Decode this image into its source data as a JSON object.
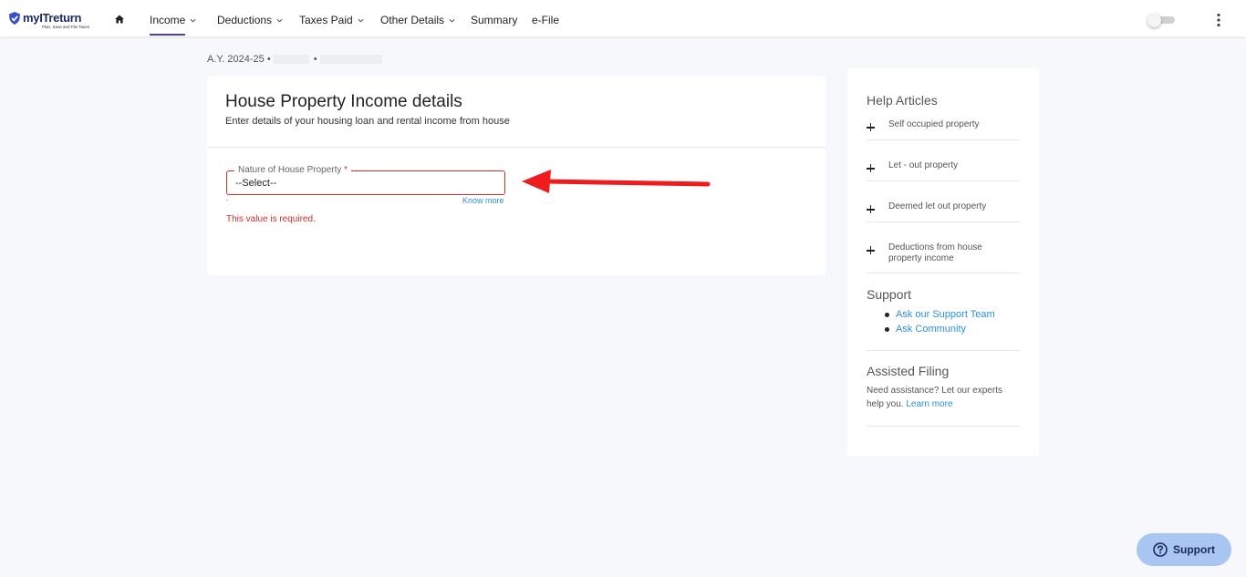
{
  "brand": {
    "name": "myITreturn",
    "tagline": "Plan, Save and File Taxes"
  },
  "nav": {
    "items": [
      {
        "label": "Income",
        "has_dropdown": true,
        "active": true
      },
      {
        "label": "Deductions",
        "has_dropdown": true
      },
      {
        "label": "Taxes Paid",
        "has_dropdown": true
      },
      {
        "label": "Other Details",
        "has_dropdown": true
      },
      {
        "label": "Summary",
        "has_dropdown": false
      },
      {
        "label": "e-File",
        "has_dropdown": false
      }
    ],
    "accent_color": "#4a3fb8"
  },
  "breadcrumb": {
    "assessment_year": "A.Y. 2024-25 •",
    "separator": "•"
  },
  "form": {
    "title": "House Property Income details",
    "subtitle": "Enter details of your housing loan and rental income from house",
    "nature_field": {
      "label": "Nature of House Property",
      "required_mark": "*",
      "value": "--Select--",
      "know_more": "Know more",
      "error": "This value is required."
    },
    "error_color": "#c9302c"
  },
  "help": {
    "title": "Help Articles",
    "articles": [
      "Self occupied property",
      "Let - out property",
      "Deemed let out property",
      "Deductions from house property income"
    ],
    "support": {
      "title": "Support",
      "links": [
        "Ask our Support Team",
        "Ask Community"
      ]
    },
    "assisted": {
      "title": "Assisted Filing",
      "text": "Need assistance? Let our experts help you.",
      "link": "Learn more"
    }
  },
  "support_button": {
    "label": "Support",
    "color": "#a9c5f2"
  },
  "icons": [
    "shield-check-icon",
    "home-icon",
    "chevron-down-icon",
    "toggle-switch",
    "kebab-menu-icon",
    "plus-icon",
    "help-circle-icon",
    "red-arrow-annotation"
  ]
}
